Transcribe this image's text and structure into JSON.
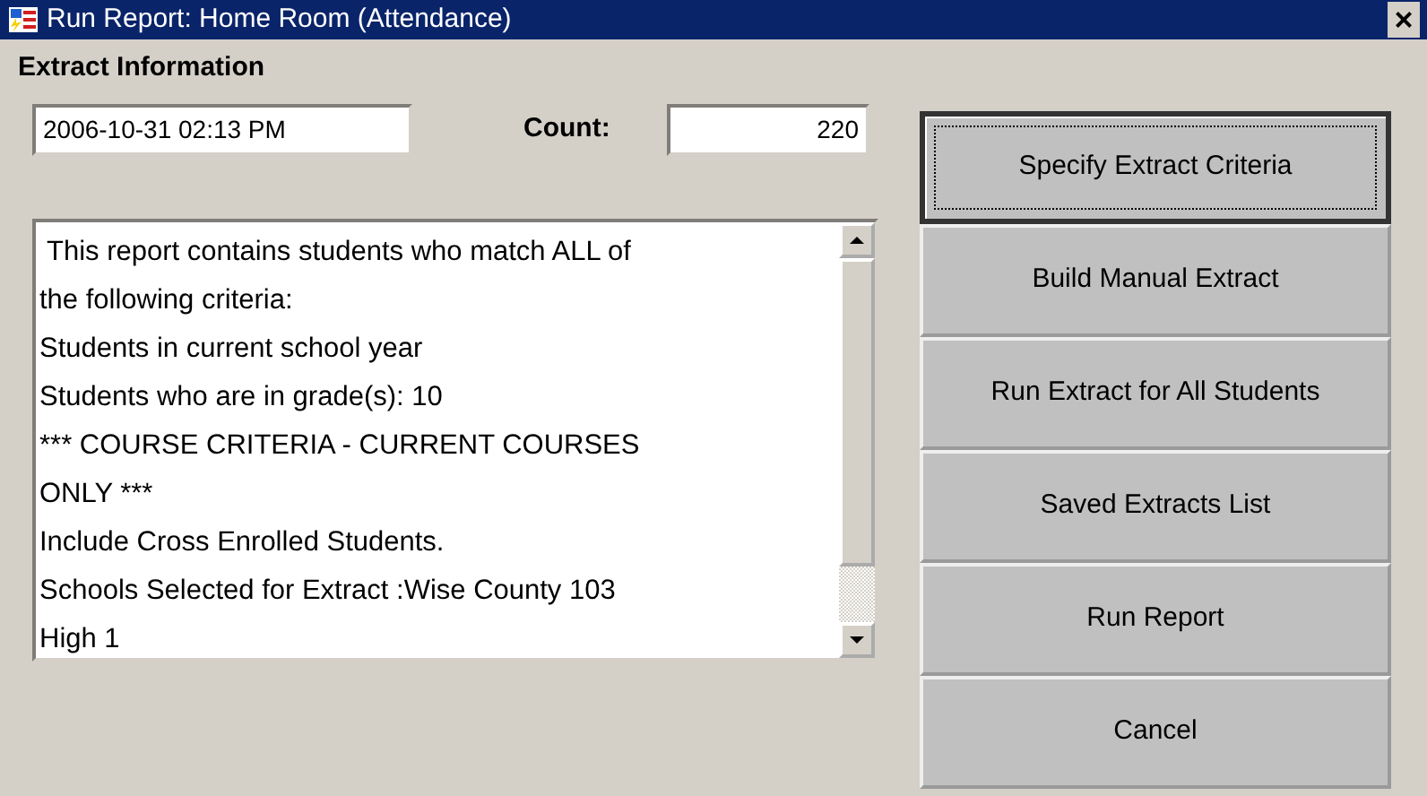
{
  "window": {
    "title": "Run Report: Home Room (Attendance)",
    "close": "×"
  },
  "section_title": "Extract Information",
  "date_field": {
    "value": "2006-10-31 02:13 PM"
  },
  "count": {
    "label": "Count:",
    "value": "220"
  },
  "criteria": {
    "lines": [
      " This report contains students who match ALL of",
      "the following criteria:",
      "Students in current school year",
      "Students who are in grade(s): 10",
      "*** COURSE CRITERIA - CURRENT COURSES",
      "ONLY ***",
      "Include Cross Enrolled Students.",
      "Schools Selected for Extract :Wise County 103",
      "High 1"
    ]
  },
  "buttons": [
    {
      "label": "Specify Extract Criteria",
      "default": true
    },
    {
      "label": "Build Manual Extract",
      "default": false
    },
    {
      "label": "Run Extract for All Students",
      "default": false
    },
    {
      "label": "Saved Extracts List",
      "default": false
    },
    {
      "label": "Run Report",
      "default": false
    },
    {
      "label": "Cancel",
      "default": false
    }
  ]
}
